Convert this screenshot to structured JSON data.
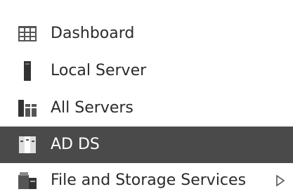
{
  "nav": {
    "items": [
      {
        "label": "Dashboard",
        "icon": "dashboard-grid-icon",
        "selected": false
      },
      {
        "label": "Local Server",
        "icon": "local-server-icon",
        "selected": false
      },
      {
        "label": "All Servers",
        "icon": "all-servers-icon",
        "selected": false
      },
      {
        "label": "AD DS",
        "icon": "ad-ds-server-icon",
        "selected": true
      },
      {
        "label": "File and Storage Services",
        "icon": "file-storage-icon",
        "selected": false,
        "has_submenu": true
      }
    ]
  },
  "colors": {
    "selected_background": "#4a4a4a",
    "selected_text": "#ffffff",
    "text": "#2b2b2b",
    "icon": "#555555"
  }
}
